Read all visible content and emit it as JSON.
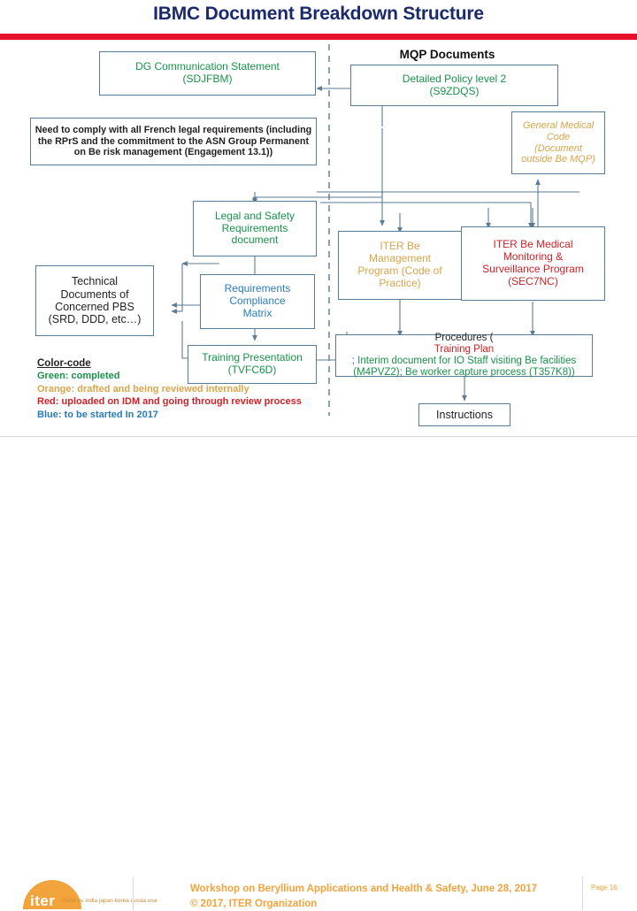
{
  "slide": {
    "title": "IBMC Document Breakdown Structure",
    "accent_red": "#e8112d",
    "accent_orange": "#f2a33c"
  },
  "diagram": {
    "section_header": "MQP Documents",
    "boxes": {
      "dg_communication": {
        "line1": "DG Communication Statement",
        "line2": "(SDJFBM)",
        "color": "#18924b"
      },
      "detailed_policy": {
        "line1": "Detailed Policy level 2",
        "line2": "(S9ZDQS)",
        "color": "#18924b"
      },
      "need_to_comply": {
        "line1": "Need to comply with all French legal requirements (including",
        "line2": "the RPrS and the commitment to the ASN Group Permanent",
        "line3": "on Be risk management (Engagement 13.1))",
        "color": "#231f20"
      },
      "general_medical_code": {
        "line1": "General Medical",
        "line2": "Code",
        "line3": "(Document",
        "line4": "outside Be MQP)",
        "color": "#d9a44a"
      },
      "legal_safety": {
        "line1": "Legal and Safety",
        "line2": "Requirements",
        "line3": "document",
        "color": "#18924b"
      },
      "iter_be_management": {
        "line1": "ITER Be",
        "line2": "Management",
        "line3": "Program  (Code of",
        "line4": "Practice)",
        "color": "#d9a44a"
      },
      "iter_be_medical": {
        "line1": "ITER Be Medical",
        "line2": "Monitoring &",
        "line3": "Surveillance Program",
        "line4": "(SEC7NC)",
        "color": "#cf2127"
      },
      "technical_documents": {
        "line1": "Technical",
        "line2": "Documents of",
        "line3": "Concerned PBS",
        "line4": "(SRD, DDD, etc…)",
        "color": "#231f20"
      },
      "requirements_matrix": {
        "line1": "Requirements",
        "line2": "Compliance",
        "line3": "Matrix",
        "color": "#2b7bb9"
      },
      "training_presentation": {
        "line1": "Training Presentation",
        "line2": "(TVFC6D)",
        "color": "#18924b"
      },
      "procedures": {
        "part1": "Procedures (",
        "part2": "Training  Plan",
        "part3": " ; Interim document for IO Staff visiting Be facilities (M4PVZ2); Be worker capture process (T357K8))"
      },
      "instructions": {
        "label": "Instructions",
        "color": "#231f20"
      }
    }
  },
  "legend": {
    "title": "Color-code",
    "items": [
      {
        "text": "Green: completed",
        "color": "#18924b"
      },
      {
        "text": "Orange: drafted and being reviewed internally",
        "color": "#d9a44a"
      },
      {
        "text": "Red: uploaded on IDM and going through review process",
        "color": "#cf2127"
      },
      {
        "text": "Blue: to be started In 2017",
        "color": "#2b7bb9"
      }
    ]
  },
  "footer": {
    "logo_word": "iter",
    "logo_countries": "china eu india japan korea russia usa",
    "line1": "Workshop on Beryllium Applications and Health & Safety, June 28, 2017",
    "line2": "© 2017, ITER Organization",
    "page": "Page 16"
  }
}
